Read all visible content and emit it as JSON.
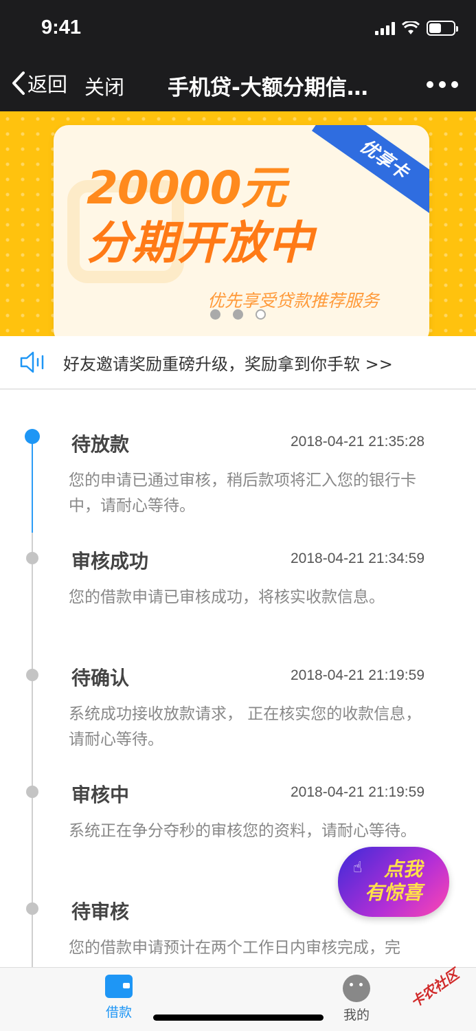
{
  "status_bar": {
    "time": "9:41"
  },
  "nav": {
    "back_label": "返回",
    "close_label": "关闭",
    "title": "手机贷-大额分期信…"
  },
  "banner": {
    "amount": "20000元",
    "headline": "分期开放中",
    "subtitle": "优先享受贷款推荐服务",
    "ribbon": "优享卡",
    "page_count": 3,
    "active_page": 3
  },
  "notice": {
    "text": "好友邀请奖励重磅升级，奖励拿到你手软 >>"
  },
  "timeline": [
    {
      "title": "待放款",
      "time": "2018-04-21 21:35:28",
      "desc": "您的申请已通过审核，稍后款项将汇入您的银行卡中，请耐心等待。",
      "active": true
    },
    {
      "title": "审核成功",
      "time": "2018-04-21 21:34:59",
      "desc": "您的借款申请已审核成功，将核实收款信息。",
      "active": false
    },
    {
      "title": "待确认",
      "time": "2018-04-21 21:19:59",
      "desc": "系统成功接收放款请求， 正在核实您的收款信息，请耐心等待。",
      "active": false
    },
    {
      "title": "审核中",
      "time": "2018-04-21 21:19:59",
      "desc": "系统正在争分夺秒的审核您的资料，请耐心等待。",
      "active": false
    },
    {
      "title": "待审核",
      "time": "2018-04-2",
      "desc": "您的借款申请预计在两个工作日内审核完成，完",
      "active": false
    }
  ],
  "promo": {
    "line1": "点我",
    "line2": "有惊喜"
  },
  "tabbar": {
    "loan_label": "借款",
    "mine_label": "我的"
  },
  "watermark": "卡农社区",
  "colors": {
    "accent": "#1e96f5",
    "banner_bg": "#ffc20e",
    "nav_bg": "#1c1c1e"
  }
}
